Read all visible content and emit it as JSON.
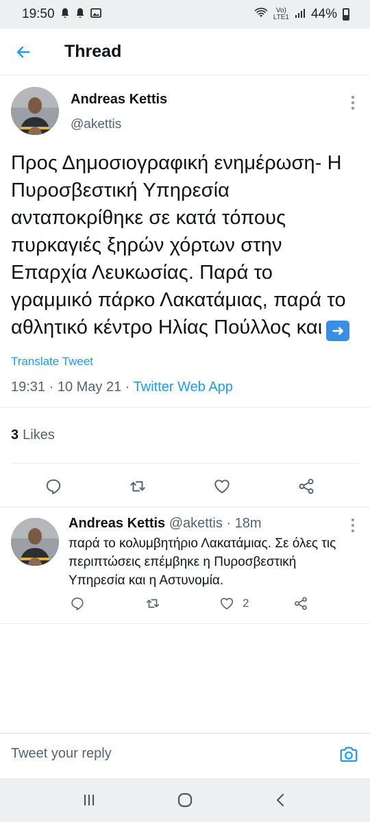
{
  "status_bar": {
    "time": "19:50",
    "network_top": "Vo)",
    "network_bottom": "LTE1",
    "battery": "44%",
    "battery_level": 0.44
  },
  "app_bar": {
    "title": "Thread"
  },
  "main_tweet": {
    "display_name": "Andreas Kettis",
    "handle": "@akettis",
    "text": "Προς Δημοσιογραφική ενημέρωση- Η Πυροσβεστική Υπηρεσία ανταποκρίθηκε σε κατά τόπους πυρκαγιές ξηρών χόρτων στην Επαρχία Λευκωσίας. Παρά το γραμμικό πάρκο Λακατάμιας, παρά το αθλητικό κέντρο Ηλίας Πούλλος και",
    "emoji": "➡️",
    "translate": "Translate Tweet",
    "time": "19:31",
    "date": "10 May 21",
    "source": "Twitter Web App",
    "likes_count": "3",
    "likes_label": "Likes"
  },
  "reply_tweet": {
    "display_name": "Andreas Kettis",
    "handle": "@akettis",
    "time_ago": "18m",
    "text": "παρά το κολυμβητήριο  Λακατάμιας. Σε όλες τις περιπτώσεις επέμβηκε η Πυροσβεστική Υπηρεσία και η Αστυνομία.",
    "likes_count": "2"
  },
  "composer": {
    "placeholder": "Tweet your reply"
  },
  "colors": {
    "accent": "#1d9bf0",
    "secondary_text": "#536471",
    "divider": "#e6ecf0"
  }
}
